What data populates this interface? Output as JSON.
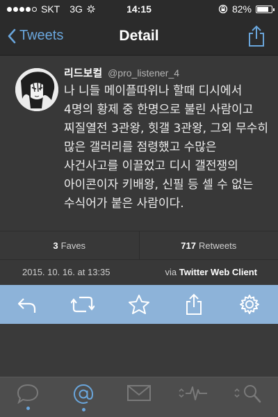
{
  "status_bar": {
    "carrier": "SKT",
    "network": "3G",
    "time": "14:15",
    "battery_percent": "82%",
    "battery_level": 0.82
  },
  "nav": {
    "back_label": "Tweets",
    "title": "Detail"
  },
  "tweet": {
    "display_name": "리드보컬",
    "handle": "@pro_listener_4",
    "text": "나 니들 메이플따위나 할때 디시에서 4명의 황제 중 한명으로 불린 사람이고 찌질열전 3관왕, 힛갤 3관왕, 그외 무수히 많은 갤러리를 점령했고 수많은 사건사고를 이끌었고 디시 갤전쟁의 아이콘이자 키배왕, 신필 등 셀 수 없는 수식어가 붙은 사람이다."
  },
  "stats": {
    "faves_count": "3",
    "faves_label": "Faves",
    "retweets_count": "717",
    "retweets_label": "Retweets"
  },
  "meta": {
    "date": "2015. 10. 16. at 13:35",
    "via_prefix": "via",
    "client": "Twitter Web Client"
  },
  "actions": [
    "reply-icon",
    "retweet-icon",
    "favorite-star-icon",
    "share-icon",
    "settings-gear-icon"
  ],
  "tabs": [
    {
      "icon": "chat-bubble-icon",
      "active": false,
      "dot": true
    },
    {
      "icon": "mention-at-icon",
      "active": true,
      "dot": true
    },
    {
      "icon": "mail-icon",
      "active": false,
      "dot": false
    },
    {
      "icon": "activity-icon",
      "active": false,
      "dot": false
    },
    {
      "icon": "search-icon",
      "active": false,
      "dot": false
    }
  ],
  "colors": {
    "accent": "#6aa6dc",
    "action_bar": "#8db3d9",
    "background": "#3a3a3a"
  }
}
